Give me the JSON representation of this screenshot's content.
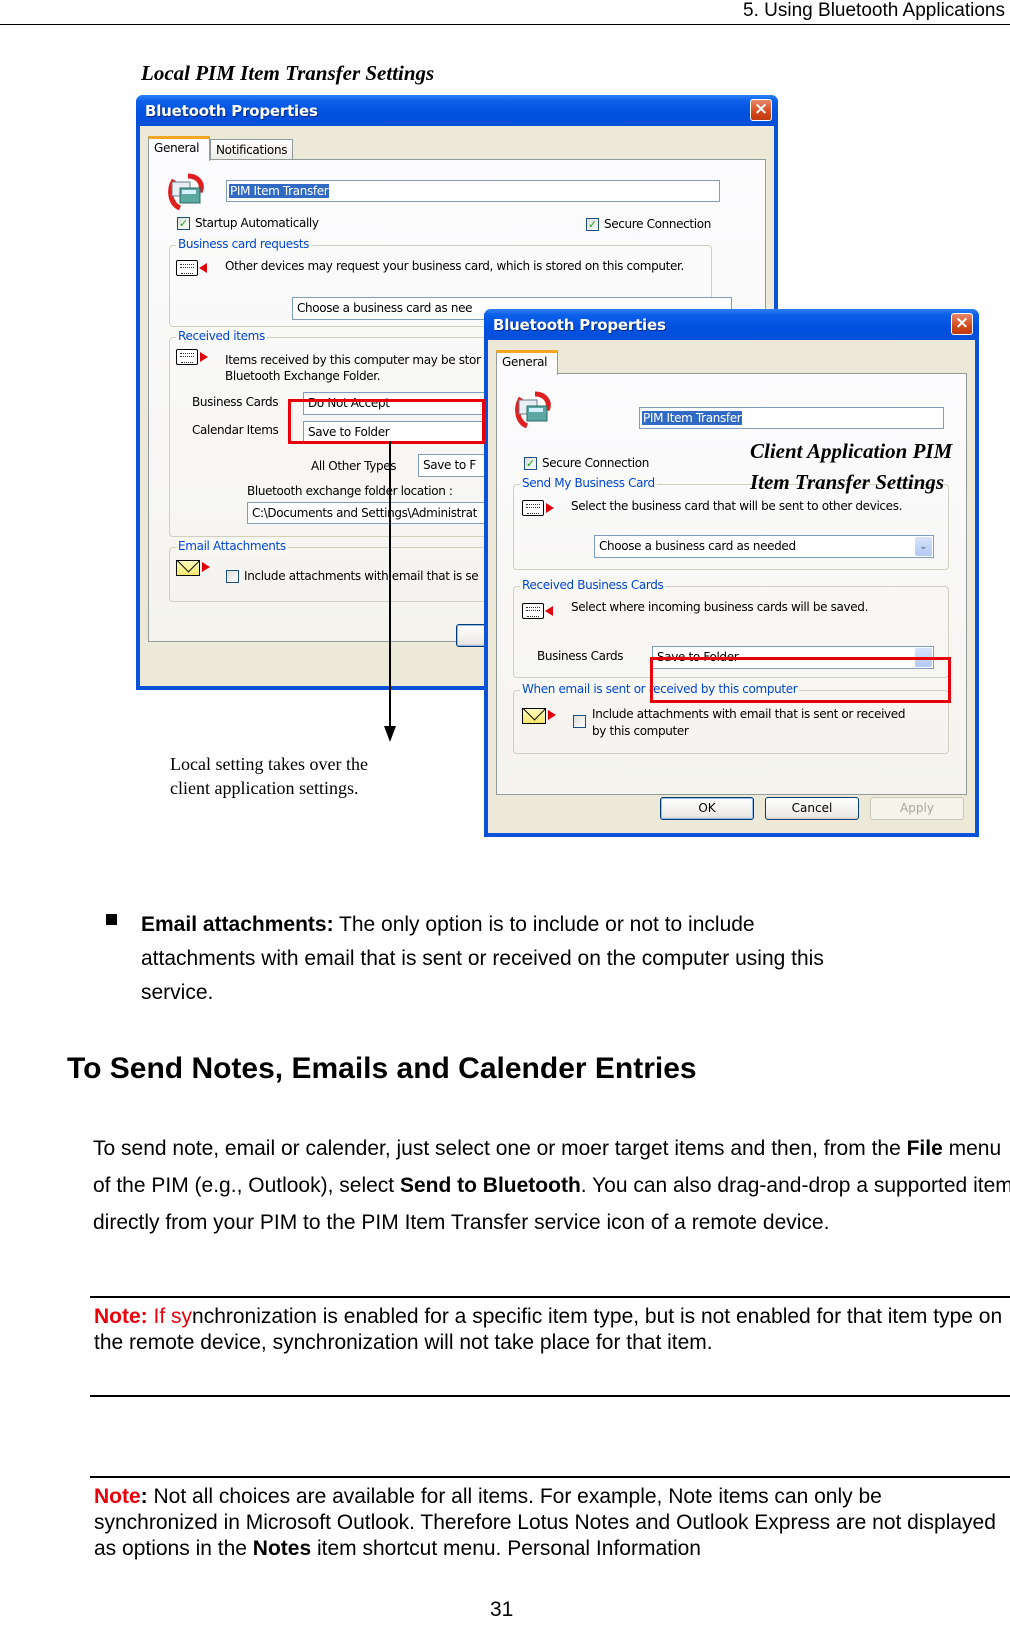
{
  "page": {
    "running_header": "5. Using Bluetooth Applications",
    "page_number": "31"
  },
  "figure": {
    "local_caption": "Local PIM Item Transfer Settings",
    "client_caption_line1": "Client Application PIM",
    "client_caption_line2": "Item Transfer Settings",
    "callout_text_line1": "Local setting takes over the",
    "callout_text_line2": "client application settings.",
    "highlight_color": "#e8000b"
  },
  "local_dialog": {
    "title": "Bluetooth Properties",
    "close_icon": "×",
    "tabs": [
      "General",
      "Notifications"
    ],
    "active_tab": "General",
    "service_name": "PIM Item Transfer",
    "startup_automatically": {
      "label": "Startup Automatically",
      "checked": true
    },
    "secure_connection": {
      "label": "Secure Connection",
      "checked": true
    },
    "business_card_requests": {
      "label": "Business card requests",
      "description": "Other devices may request your business card, which is stored on this computer.",
      "selected": "Choose a business card as nee"
    },
    "received_items": {
      "label": "Received items",
      "description_line1": "Items received by this computer may be stor",
      "description_line2": "Bluetooth Exchange Folder.",
      "business_cards": {
        "label": "Business Cards",
        "selected": "Do Not Accept"
      },
      "calendar_items": {
        "label": "Calendar Items",
        "selected": "Save to Folder"
      },
      "all_other_types": {
        "label": "All Other Types",
        "selected": "Save to F"
      },
      "folder_location_label": "Bluetooth exchange folder location :",
      "folder_location_value": "C:\\Documents and Settings\\Administrat"
    },
    "email_attachments": {
      "label": "Email Attachments",
      "checkbox_label": "Include attachments with email that is se",
      "checked": false
    }
  },
  "client_dialog": {
    "title": "Bluetooth Properties",
    "close_icon": "×",
    "tabs": [
      "General"
    ],
    "service_name": "PIM Item Transfer",
    "secure_connection": {
      "label": "Secure Connection",
      "checked": true
    },
    "send_my_business_card": {
      "label": "Send My Business Card",
      "description": "Select the business card that will be sent to other devices.",
      "selected": "Choose a business card as needed"
    },
    "received_business_cards": {
      "label": "Received Business Cards",
      "description": "Select where incoming business cards will be saved.",
      "business_cards_label": "Business Cards",
      "selected": "Save to Folder"
    },
    "email": {
      "label": "When email is sent or received by this computer",
      "checkbox_label_line1": "Include attachments with email that is sent or received",
      "checkbox_label_line2": "by this computer",
      "checked": false
    },
    "buttons": {
      "ok": "OK",
      "cancel": "Cancel",
      "apply": "Apply"
    }
  },
  "bullet": {
    "term": "Email attachments:",
    "text_line1": " The only option is to include or not to include",
    "text_line2": "attachments with email that is sent or received on the computer using this",
    "text_line3": "service."
  },
  "section": {
    "heading": "To Send Notes, Emails and Calender Entries",
    "para_1": "To send note, email or calender, just select one or moer target items and then, from the ",
    "para_bold_1": "File",
    "para_2": " menu of the PIM (e.g., Outlook), select ",
    "para_bold_2": "Send to Bluetooth",
    "para_3": ". You can also drag-and-drop a supported item directly from your PIM to the PIM Item Transfer service icon of a remote device."
  },
  "note_1": {
    "label": "Note:",
    "red_part": " If sy",
    "text": "nchronization is enabled for a specific item type, but is not enabled for that item type on the remote device, synchronization will not take place for that item."
  },
  "note_2": {
    "label": "Note",
    "colon": ":",
    "text_1": " Not all choices are available for all items. For example, Note items can only be synchronized in Microsoft Outlook. Therefore Lotus Notes and Outlook Express are not displayed as options in the ",
    "bold": "Notes",
    "text_2": " item shortcut menu. Personal Information"
  }
}
